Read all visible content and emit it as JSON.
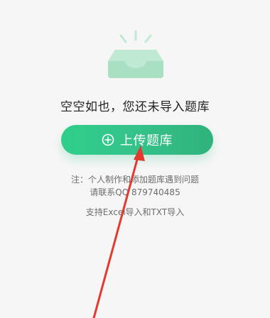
{
  "empty_state": {
    "illustration_icon": "empty-inbox-icon",
    "title": "空空如也，您还未导入题库"
  },
  "upload": {
    "icon": "plus-circle-icon",
    "label": "上传题库"
  },
  "note": {
    "line1": "注：个人制作和添加题库遇到问题",
    "line2": "请联系QQ 879740485"
  },
  "support_text": "支持Excel导入和TXT导入",
  "colors": {
    "accent": "#2ec282",
    "illustration": "#bfe9d2",
    "annotation_arrow": "#e23a2f"
  }
}
